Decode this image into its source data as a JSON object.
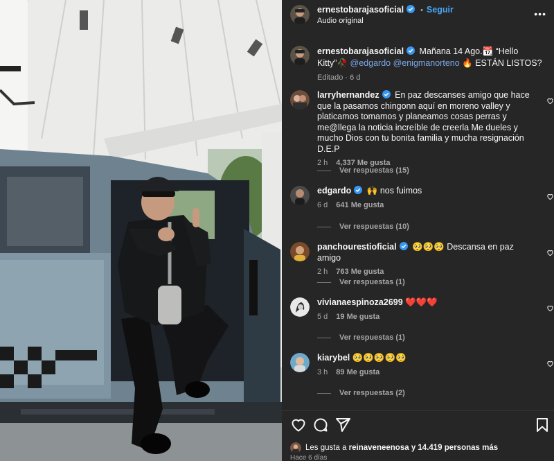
{
  "header": {
    "username": "ernestobarajasoficial",
    "follow_label": "Seguir",
    "audio_label": "Audio original",
    "separator": "•",
    "more_label": "•••"
  },
  "caption": {
    "username": "ernestobarajasoficial",
    "text_1": "Mañana 14 Ago.📆 “Hello Kitty”🥀",
    "mention_1": "@edgardo",
    "mention_2": "@enigmanorteno",
    "text_2": "🔥 ESTÁN LISTOS?",
    "edited": "Editado",
    "age": "6 d"
  },
  "comments": [
    {
      "username": "larryhernandez",
      "text": "En paz descanses amigo que hace que la pasamos chingonn aquí en moreno valley y platicamos tomamos y planeamos cosas perras y me@llega la noticia increíble de creerla Me dueles y mucho Dios con tu bonita familia y mucha resignación D.E.P",
      "age": "2 h",
      "likes": "4,337 Me gusta",
      "replies": "Ver respuestas (15)",
      "verified": true
    },
    {
      "username": "edgardo",
      "text": "🙌 nos fuimos",
      "age": "6 d",
      "likes": "641 Me gusta",
      "replies": "Ver respuestas (10)",
      "verified": true
    },
    {
      "username": "panchourestioficial",
      "text": "🥺🥺🥺 Descansa en paz amigo",
      "age": "2 h",
      "likes": "763 Me gusta",
      "replies": "Ver respuestas (1)",
      "verified": true
    },
    {
      "username": "vivianaespinoza2699",
      "text": "❤️❤️❤️",
      "age": "5 d",
      "likes": "19 Me gusta",
      "replies": "Ver respuestas (1)",
      "verified": false
    },
    {
      "username": "kiarybel",
      "text": "🥺🥺🥺🥺🥺",
      "age": "3 h",
      "likes": "89 Me gusta",
      "replies": "Ver respuestas (2)",
      "verified": false
    }
  ],
  "footer": {
    "likes_prefix": "Les gusta a",
    "likes_user": "reinaveneenosa",
    "likes_suffix": "y 14.419 personas más",
    "posted_ago": "Hace 6 días"
  },
  "icons": {
    "like": "heart-icon",
    "comment": "comment-icon",
    "share": "share-icon",
    "save": "bookmark-icon",
    "verified": "verified-badge-icon"
  },
  "colors": {
    "background": "#262626",
    "link": "#4aa3f5",
    "mention": "#7ba8e8",
    "verified": "#3897f0",
    "secondary_text": "#a8a8a8"
  }
}
